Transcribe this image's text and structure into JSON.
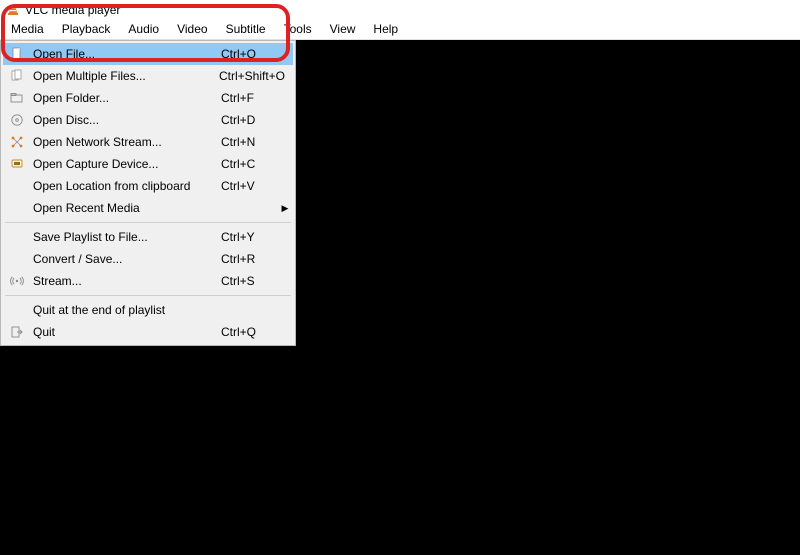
{
  "window": {
    "title": "VLC media player"
  },
  "menuBar": [
    "Media",
    "Playback",
    "Audio",
    "Video",
    "Subtitle",
    "Tools",
    "View",
    "Help"
  ],
  "mediaMenu": {
    "groups": [
      [
        {
          "icon": "file-icon",
          "label": "Open File...",
          "shortcut": "Ctrl+O",
          "highlighted": true
        },
        {
          "icon": "files-icon",
          "label": "Open Multiple Files...",
          "shortcut": "Ctrl+Shift+O"
        },
        {
          "icon": "folder-icon",
          "label": "Open Folder...",
          "shortcut": "Ctrl+F"
        },
        {
          "icon": "disc-icon",
          "label": "Open Disc...",
          "shortcut": "Ctrl+D"
        },
        {
          "icon": "network-icon",
          "label": "Open Network Stream...",
          "shortcut": "Ctrl+N"
        },
        {
          "icon": "capture-icon",
          "label": "Open Capture Device...",
          "shortcut": "Ctrl+C"
        },
        {
          "icon": "",
          "label": "Open Location from clipboard",
          "shortcut": "Ctrl+V"
        },
        {
          "icon": "",
          "label": "Open Recent Media",
          "shortcut": "",
          "submenu": true
        }
      ],
      [
        {
          "icon": "",
          "label": "Save Playlist to File...",
          "shortcut": "Ctrl+Y"
        },
        {
          "icon": "",
          "label": "Convert / Save...",
          "shortcut": "Ctrl+R"
        },
        {
          "icon": "stream-icon",
          "label": "Stream...",
          "shortcut": "Ctrl+S"
        }
      ],
      [
        {
          "icon": "",
          "label": "Quit at the end of playlist",
          "shortcut": ""
        },
        {
          "icon": "quit-icon",
          "label": "Quit",
          "shortcut": "Ctrl+Q"
        }
      ]
    ]
  }
}
